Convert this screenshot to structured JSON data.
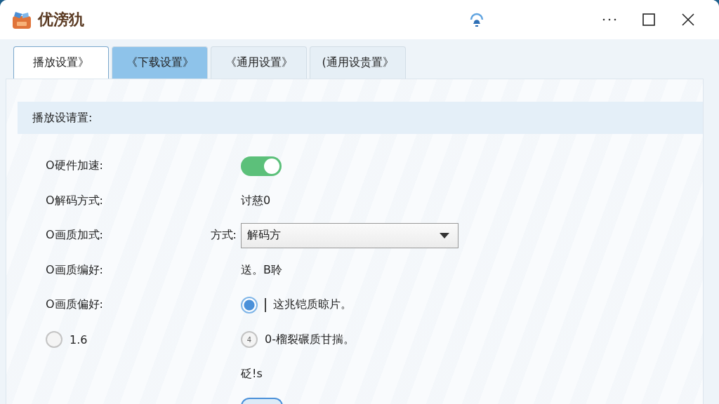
{
  "window": {
    "title": "优滂犰"
  },
  "tabs": [
    {
      "label": "播放设置》",
      "selected": true
    },
    {
      "label": "《下载设置》",
      "selected": false
    },
    {
      "label": "《通用设置》",
      "selected": false
    },
    {
      "label": "(通用设贵置》",
      "selected": false
    }
  ],
  "section": {
    "title": "播放设请置:"
  },
  "rows": [
    {
      "kind": "toggle",
      "label": "O硬件加速:",
      "on": true
    },
    {
      "kind": "text",
      "label": "O解码方式:",
      "value": "讨慈0"
    },
    {
      "kind": "select",
      "label": "O画质加式:",
      "prefix": "方式:",
      "value": "解码方"
    },
    {
      "kind": "text",
      "label": "O画质编好:",
      "value": "送。B聆"
    },
    {
      "kind": "radio",
      "label": "O画质偏好:",
      "option": {
        "label": "这兆铠质晾片。",
        "selected": true
      }
    },
    {
      "kind": "radio",
      "left_option": {
        "label": "1.6",
        "selected": false
      },
      "option": {
        "glyph": "4",
        "label": "0-榴裂碾质甘揣。"
      }
    },
    {
      "kind": "text",
      "value": "砭!s"
    }
  ]
}
